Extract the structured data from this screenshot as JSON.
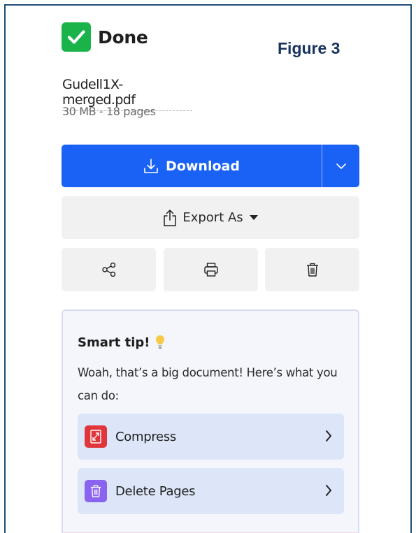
{
  "status": {
    "title": "Done"
  },
  "figure_label": "Figure 3",
  "file": {
    "name": "Gudell1X-merged.pdf",
    "meta": "30 MB - 18 pages"
  },
  "buttons": {
    "download": "Download",
    "export": "Export As"
  },
  "icons": {
    "status": "check-icon",
    "download": "download-icon",
    "dropdown": "chevron-down-icon",
    "export": "share-upload-icon",
    "share": "share-icon",
    "print": "printer-icon",
    "delete": "trash-icon",
    "tip": "lightbulb-icon",
    "compress": "compress-icon",
    "delete_pages": "trash-icon",
    "next": "chevron-right-icon"
  },
  "smart_tip": {
    "title": "Smart tip!",
    "body": "Woah, that’s a big document! Here’s what you can do:",
    "actions": [
      {
        "label": "Compress"
      },
      {
        "label": "Delete Pages"
      }
    ]
  },
  "colors": {
    "primary": "#1a62f5",
    "success": "#19b34a",
    "compress": "#e0353b",
    "delete_pages": "#8a63ee"
  }
}
